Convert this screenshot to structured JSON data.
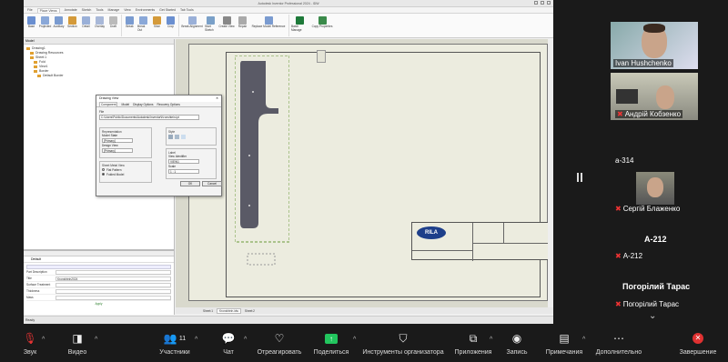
{
  "window": {
    "title": "Autodesk Inventor Professional 2024 - IDW"
  },
  "tabs": [
    "File",
    "Place Views",
    "Annotate",
    "Sketch",
    "Tools",
    "Manage",
    "View",
    "Environments",
    "Get Started",
    "Tab Tools"
  ],
  "active_tab": "Place Views",
  "ribbon": [
    "Base",
    "Projected",
    "Auxiliary",
    "Section",
    "Detail",
    "Overlay",
    "Draft",
    "Break",
    "Break Out",
    "Slice",
    "Crop",
    "Break Alignment",
    "Start Sketch",
    "Create View",
    "Repair",
    "Replace Model Reference",
    "Batch Manage",
    "Copy Properties"
  ],
  "ribbon_accent": "#1e7a3a",
  "model_tree": [
    "Model",
    "Drawing1",
    "Drawing Resources",
    "Sheet:1",
    "Fold",
    "View1",
    "Border",
    "Default Border"
  ],
  "properties": {
    "header": "Default",
    "rows": [
      {
        "k": "Part Description",
        "v": ""
      },
      {
        "k": "Title",
        "v": "Kronshtein2024"
      },
      {
        "k": "Surface Treatment",
        "v": ""
      },
      {
        "k": "Thickness",
        "v": ""
      },
      {
        "k": "Mass",
        "v": ""
      }
    ],
    "apply": "Apply"
  },
  "status": "Ready",
  "sheet_tabs": [
    "Sheet:1",
    "Kronshtein.idw",
    "Sheet:2"
  ],
  "titleblock": {
    "logo": "RILA"
  },
  "dialog": {
    "title": "Drawing View",
    "tabs": [
      "Component",
      "Model",
      "Display Options",
      "Recovery Options"
    ],
    "file_label": "File",
    "file_path": "C:\\Users\\Public\\Documents\\Autodesk\\Inventor\\Kronshtein.ipt",
    "representation_label": "Representation",
    "model_state": "Model State",
    "primary": "[Primary]",
    "design_view": "Design View",
    "sheet_metal_view": "Sheet Metal View",
    "radio_options": [
      "Flat Pattern",
      "Folded Model"
    ],
    "style_label": "Style",
    "label_label": "Label",
    "view_identifier": "View Identifier",
    "view_id_value": "VIEW1",
    "scale_label": "Scale",
    "scale_value": "1 : 1",
    "ok": "OK",
    "cancel": "Cancel"
  },
  "participants": [
    {
      "name": "Ivan Hushchenko",
      "muted": false
    },
    {
      "name": "Андрій Кобзенко",
      "muted": true
    },
    {
      "name": "a-314",
      "muted": false
    },
    {
      "name": "Сергій Блаженко",
      "muted": true
    },
    {
      "name": "A-212",
      "muted": false
    },
    {
      "name": "A-212",
      "muted": true
    },
    {
      "name": "Погорілий Тарас",
      "muted": false
    },
    {
      "name": "Погорілий Тарас",
      "muted": true
    }
  ],
  "more_label": "⌄",
  "toolbar": {
    "audio": "Звук",
    "video": "Видео",
    "participants": "Участники",
    "participants_count": "11",
    "chat": "Чат",
    "reactions": "Отреагировать",
    "share": "Поделиться",
    "host_tools": "Инструменты организатора",
    "apps": "Приложения",
    "record": "Запись",
    "notes": "Примечания",
    "more": "Дополнительно",
    "end": "Завершение"
  },
  "colors": {
    "share_accent": "#22c55e",
    "end_red": "#e03131",
    "mute_red": "#e33333"
  }
}
